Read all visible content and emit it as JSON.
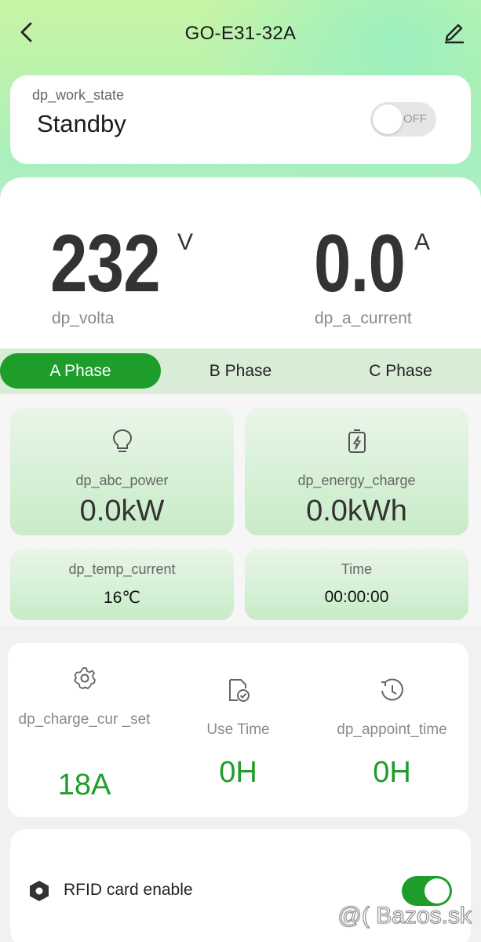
{
  "header": {
    "title": "GO-E31-32A",
    "back_icon": "chevron-left-icon",
    "edit_icon": "pencil-icon"
  },
  "work_state": {
    "label": "dp_work_state",
    "value": "Standby",
    "toggle_text": "OFF",
    "toggle_on": false
  },
  "metrics": {
    "voltage": {
      "value": "232",
      "unit": "V",
      "label": "dp_volta"
    },
    "current": {
      "value": "0.0",
      "unit": "A",
      "label": "dp_a_current"
    }
  },
  "phases": {
    "tabs": [
      {
        "label": "A Phase",
        "active": true
      },
      {
        "label": "B Phase",
        "active": false
      },
      {
        "label": "C Phase",
        "active": false
      }
    ]
  },
  "stats": {
    "power": {
      "label": "dp_abc_power",
      "value": "0.0kW",
      "icon": "lightbulb-icon"
    },
    "energy": {
      "label": "dp_energy_charge",
      "value": "0.0kWh",
      "icon": "battery-charge-icon"
    },
    "temp": {
      "label": "dp_temp_current",
      "value": "16℃"
    },
    "time": {
      "label": "Time",
      "value": "00:00:00"
    }
  },
  "settings": {
    "charge_current": {
      "label": "dp_charge_cur _set",
      "value": "18A",
      "icon": "gear-icon"
    },
    "use_time": {
      "label": "Use Time",
      "value": "0H",
      "icon": "file-check-icon"
    },
    "appoint_time": {
      "label": "dp_appoint_time",
      "value": "0H",
      "icon": "clock-history-icon"
    }
  },
  "rfid": {
    "label": "RFID card enable",
    "enabled": true,
    "icon": "hexagon-icon"
  },
  "watermark": {
    "text": "@( Bazos.sk"
  },
  "colors": {
    "accent": "#1f9d2a",
    "tab_bar": "#d8ecd6"
  }
}
